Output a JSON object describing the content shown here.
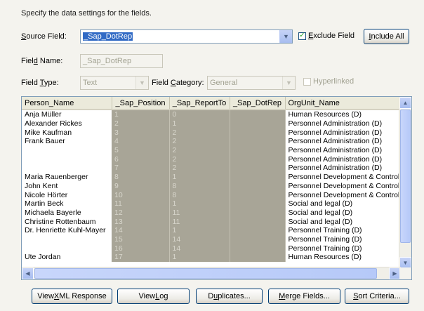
{
  "hint": "Specify the data settings for the fields.",
  "source_field": {
    "label_pre": "",
    "label_u": "S",
    "label_post": "ource Field:",
    "value": "_Sap_DotRep"
  },
  "exclude_field": {
    "label_u": "E",
    "label_post": "xclude Field",
    "checked_glyph": "✓"
  },
  "include_all": {
    "label_u": "I",
    "label_post": "nclude All"
  },
  "field_name": {
    "label_pre": "Fiel",
    "label_u": "d",
    "label_post": " Name:",
    "value": "_Sap_DotRep"
  },
  "field_type": {
    "label_pre": "Field ",
    "label_u": "T",
    "label_post": "ype:",
    "value": "Text"
  },
  "field_category": {
    "label_pre": "Field ",
    "label_u": "C",
    "label_post": "ategory:",
    "value": "General"
  },
  "hyperlinked": {
    "label": "Hyperlinked"
  },
  "grid": {
    "columns": [
      "Person_Name",
      "_Sap_Position",
      "_Sap_ReportTo",
      "_Sap_DotRep",
      "OrgUnit_Name"
    ],
    "rows": [
      [
        "Anja Müller",
        "1",
        "0",
        "",
        "Human Resources (D)"
      ],
      [
        "Alexander Rickes",
        "2",
        "1",
        "",
        "Personnel Administration (D)"
      ],
      [
        "Mike Kaufman",
        "3",
        "2",
        "",
        "Personnel Administration (D)"
      ],
      [
        "Frank Bauer",
        "4",
        "2",
        "",
        "Personnel Administration (D)"
      ],
      [
        "",
        "5",
        "2",
        "",
        "Personnel Administration (D)"
      ],
      [
        "",
        "6",
        "2",
        "",
        "Personnel Administration (D)"
      ],
      [
        "",
        "7",
        "2",
        "",
        "Personnel Administration (D)"
      ],
      [
        "Maria Rauenberger",
        "8",
        "1",
        "",
        "Personnel Development & Controllir"
      ],
      [
        "John Kent",
        "9",
        "8",
        "",
        "Personnel Development & Controllir"
      ],
      [
        "Nicole Hörter",
        "10",
        "8",
        "",
        "Personnel Development & Controllir"
      ],
      [
        "Martin Beck",
        "11",
        "1",
        "",
        "Social and legal (D)"
      ],
      [
        "Michaela Bayerle",
        "12",
        "11",
        "",
        "Social and legal (D)"
      ],
      [
        "Christine Rottenbaum",
        "13",
        "11",
        "",
        "Social and legal (D)"
      ],
      [
        "Dr. Henriette Kuhl-Mayer",
        "14",
        "1",
        "",
        "Personnel Training (D)"
      ],
      [
        "",
        "15",
        "14",
        "",
        "Personnel Training (D)"
      ],
      [
        "",
        "16",
        "14",
        "",
        "Personnel Training (D)"
      ],
      [
        "Ute Jordan",
        "17",
        "1",
        "",
        "Human Resources (D)"
      ]
    ]
  },
  "buttons": {
    "view_xml": {
      "pre": "View ",
      "u": "X",
      "post": "ML Response"
    },
    "view_log": {
      "pre": "View ",
      "u": "L",
      "post": "og"
    },
    "duplicates": {
      "pre": "D",
      "u": "u",
      "post": "plicates..."
    },
    "merge_fields": {
      "pre": "",
      "u": "M",
      "post": "erge Fields..."
    },
    "sort_criteria": {
      "pre": "",
      "u": "S",
      "post": "ort Criteria..."
    }
  },
  "icons": {
    "dropdown": "▼",
    "scroll_up": "▲",
    "scroll_down": "▼",
    "scroll_left": "◀",
    "scroll_right": "▶"
  }
}
